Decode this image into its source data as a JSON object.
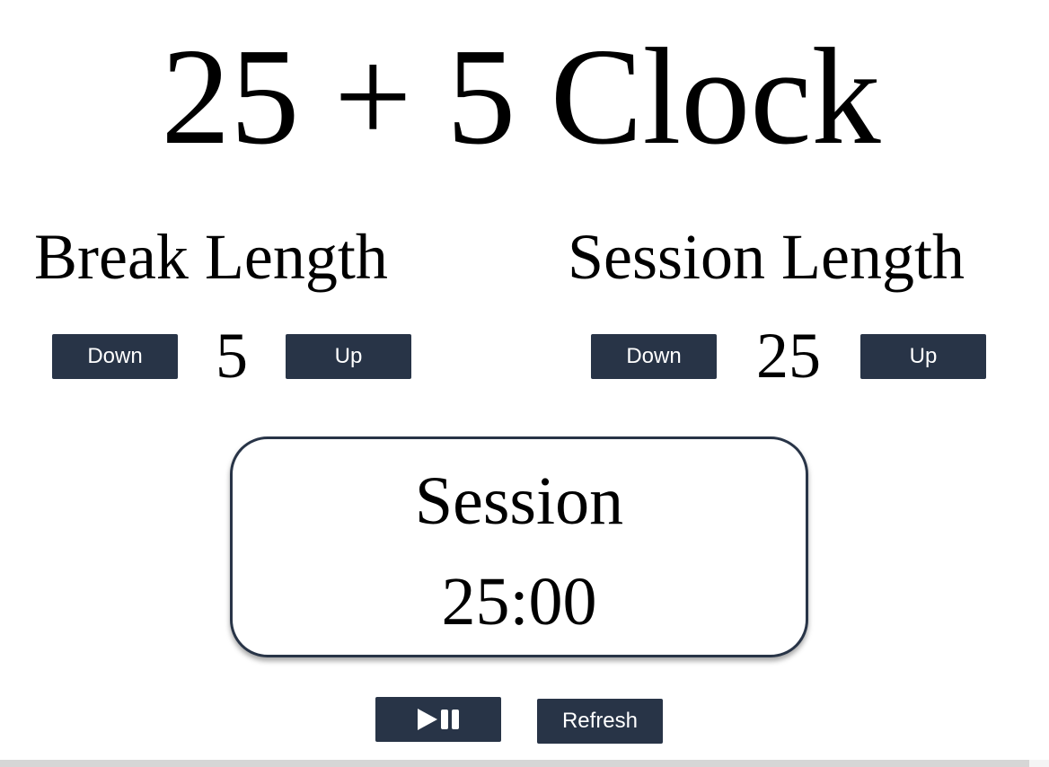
{
  "app": {
    "title": "25 + 5 Clock"
  },
  "break": {
    "label": "Break Length",
    "value": "5",
    "down_label": "Down",
    "up_label": "Up"
  },
  "session": {
    "label": "Session Length",
    "value": "25",
    "down_label": "Down",
    "up_label": "Up"
  },
  "timer": {
    "label": "Session",
    "time_left": "25:00"
  },
  "controls": {
    "start_stop_icon": "play-pause-icon",
    "reset_label": "Refresh"
  },
  "colors": {
    "button_bg": "#283447",
    "button_text": "#ffffff",
    "timer_border": "#283447"
  }
}
